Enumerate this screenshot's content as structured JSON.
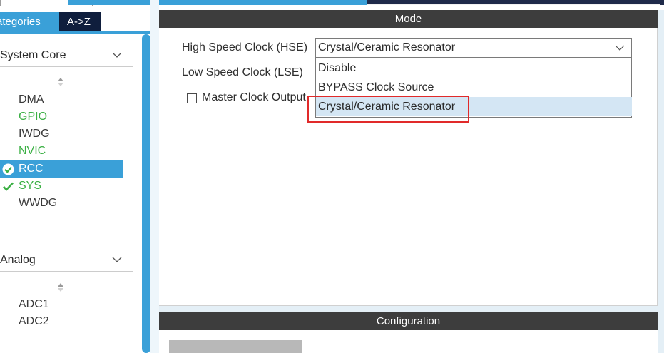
{
  "left_panel": {
    "tabs": [
      {
        "label": "ategories",
        "active": true
      },
      {
        "label": "A->Z",
        "active": false
      }
    ],
    "categories": [
      {
        "label": "System Core",
        "expanded": true,
        "items": [
          {
            "label": "DMA",
            "color": "#3a3a3a"
          },
          {
            "label": "GPIO",
            "color": "#3cb045"
          },
          {
            "label": "IWDG",
            "color": "#3a3a3a"
          },
          {
            "label": "NVIC",
            "color": "#3cb045"
          },
          {
            "label": "RCC",
            "selected": true,
            "check": true
          },
          {
            "label": "SYS",
            "color": "#3cb045",
            "check": true
          },
          {
            "label": "WWDG",
            "color": "#3a3a3a"
          }
        ]
      },
      {
        "label": "Analog",
        "expanded": true,
        "items": [
          {
            "label": "ADC1"
          },
          {
            "label": "ADC2"
          }
        ]
      }
    ]
  },
  "mode": {
    "title": "Mode",
    "hse_label": "High Speed Clock (HSE)",
    "hse_value": "Crystal/Ceramic Resonator",
    "lse_label": "Low Speed Clock (LSE)",
    "mco_label": "Master Clock Output",
    "mco_checked": false,
    "dropdown_options": [
      "Disable",
      "BYPASS Clock Source",
      "Crystal/Ceramic Resonator"
    ],
    "highlighted_option": "Crystal/Ceramic Resonator"
  },
  "configuration": {
    "title": "Configuration"
  },
  "colors": {
    "accent": "#3aa0d8",
    "navy": "#0f1e3d",
    "header_dark": "#3d3d3d",
    "green": "#3cb045",
    "highlight": "#d4e6f4",
    "annotation_red": "#e12a2a"
  }
}
